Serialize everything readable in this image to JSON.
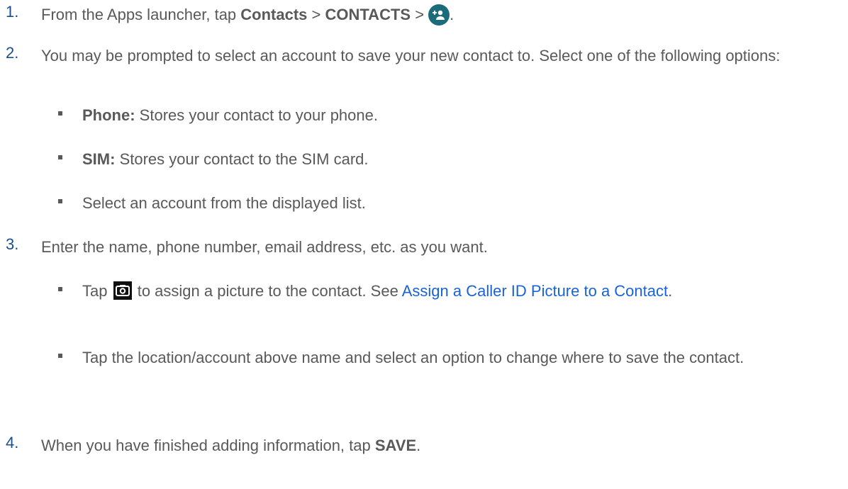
{
  "steps": [
    {
      "num": "1.",
      "t1": "From the Apps launcher, tap ",
      "b1": "Contacts",
      "t2": " > ",
      "b2": "CONTACTS",
      "t3": " > ",
      "t4": ".",
      "icon": "add-contact-icon"
    },
    {
      "num": "2.",
      "text": "You may be prompted to select an account to save your new contact to. Select one of the following options:",
      "bullets": [
        {
          "bold": "Phone:",
          "text": " Stores your contact to your phone."
        },
        {
          "bold": "SIM:",
          "text": " Stores your contact to the SIM card."
        },
        {
          "bold": "",
          "text": "Select an account from the displayed list."
        }
      ]
    },
    {
      "num": "3.",
      "text": "Enter the name, phone number, email address, etc. as you want.",
      "bullets": [
        {
          "t1": "Tap ",
          "icon": "camera-icon",
          "t2": " to assign a picture to the contact. See ",
          "link": "Assign a Caller ID Picture to a Contact",
          "t3": "."
        },
        {
          "text": "Tap the location/account above name and select an option to change where to save the contact."
        }
      ]
    },
    {
      "num": "4.",
      "t1": "When you have finished adding information, tap ",
      "b1": "SAVE",
      "t2": "."
    }
  ],
  "colors": {
    "text": "#595959",
    "number": "#1b4f8a",
    "link": "#1a63d6",
    "fab": "#1c6b7a"
  }
}
